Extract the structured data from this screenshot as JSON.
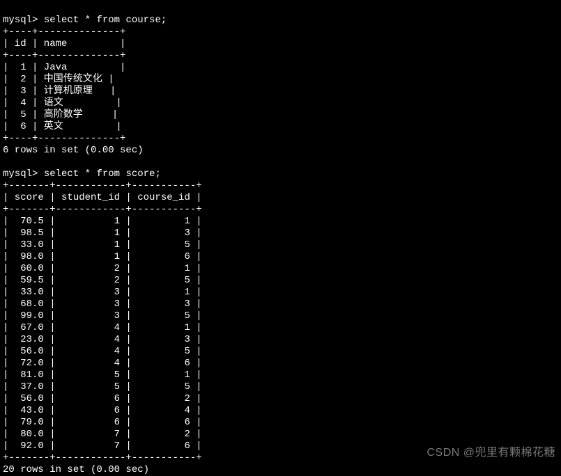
{
  "prompt": "mysql>",
  "query1": {
    "command": "select * from course;",
    "border_top": "+----+--------------+",
    "header": "| id | name         |",
    "border_mid": "+----+--------------+",
    "rows": [
      "|  1 | Java         |",
      "|  2 | 中国传统文化 |",
      "|  3 | 计算机原理   |",
      "|  4 | 语文         |",
      "|  5 | 高阶数学     |",
      "|  6 | 英文         |"
    ],
    "border_bot": "+----+--------------+",
    "summary": "6 rows in set (0.00 sec)"
  },
  "query2": {
    "command": "select * from score;",
    "border_top": "+-------+------------+-----------+",
    "header": "| score | student_id | course_id |",
    "border_mid": "+-------+------------+-----------+",
    "rows": [
      "|  70.5 |          1 |         1 |",
      "|  98.5 |          1 |         3 |",
      "|  33.0 |          1 |         5 |",
      "|  98.0 |          1 |         6 |",
      "|  60.0 |          2 |         1 |",
      "|  59.5 |          2 |         5 |",
      "|  33.0 |          3 |         1 |",
      "|  68.0 |          3 |         3 |",
      "|  99.0 |          3 |         5 |",
      "|  67.0 |          4 |         1 |",
      "|  23.0 |          4 |         3 |",
      "|  56.0 |          4 |         5 |",
      "|  72.0 |          4 |         6 |",
      "|  81.0 |          5 |         1 |",
      "|  37.0 |          5 |         5 |",
      "|  56.0 |          6 |         2 |",
      "|  43.0 |          6 |         4 |",
      "|  79.0 |          6 |         6 |",
      "|  80.0 |          7 |         2 |",
      "|  92.0 |          7 |         6 |"
    ],
    "border_bot": "+-------+------------+-----------+",
    "summary": "20 rows in set (0.00 sec)"
  },
  "watermark": "CSDN @兜里有颗棉花糖",
  "chart_data": [
    {
      "type": "table",
      "title": "course",
      "columns": [
        "id",
        "name"
      ],
      "rows": [
        [
          1,
          "Java"
        ],
        [
          2,
          "中国传统文化"
        ],
        [
          3,
          "计算机原理"
        ],
        [
          4,
          "语文"
        ],
        [
          5,
          "高阶数学"
        ],
        [
          6,
          "英文"
        ]
      ]
    },
    {
      "type": "table",
      "title": "score",
      "columns": [
        "score",
        "student_id",
        "course_id"
      ],
      "rows": [
        [
          70.5,
          1,
          1
        ],
        [
          98.5,
          1,
          3
        ],
        [
          33.0,
          1,
          5
        ],
        [
          98.0,
          1,
          6
        ],
        [
          60.0,
          2,
          1
        ],
        [
          59.5,
          2,
          5
        ],
        [
          33.0,
          3,
          1
        ],
        [
          68.0,
          3,
          3
        ],
        [
          99.0,
          3,
          5
        ],
        [
          67.0,
          4,
          1
        ],
        [
          23.0,
          4,
          3
        ],
        [
          56.0,
          4,
          5
        ],
        [
          72.0,
          4,
          6
        ],
        [
          81.0,
          5,
          1
        ],
        [
          37.0,
          5,
          5
        ],
        [
          56.0,
          6,
          2
        ],
        [
          43.0,
          6,
          4
        ],
        [
          79.0,
          6,
          6
        ],
        [
          80.0,
          7,
          2
        ],
        [
          92.0,
          7,
          6
        ]
      ]
    }
  ]
}
